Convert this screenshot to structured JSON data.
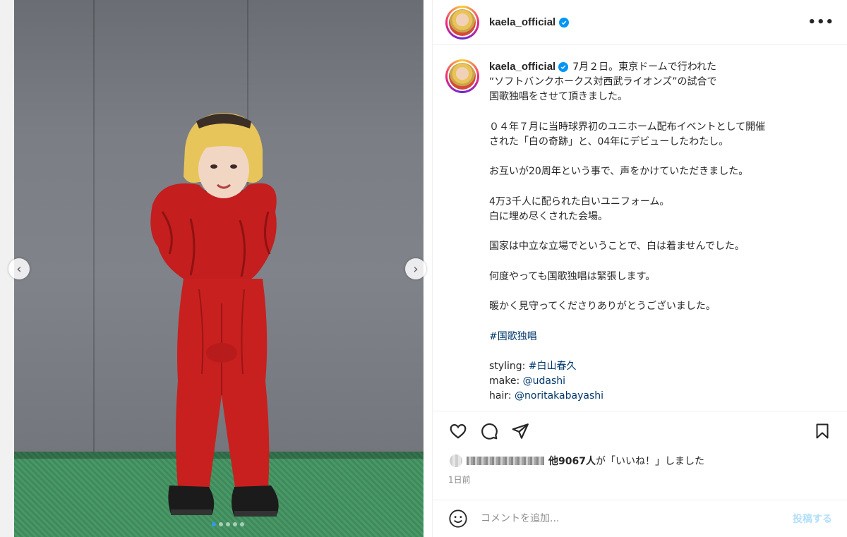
{
  "post": {
    "username": "kaela_official",
    "verified_icon": "verified-badge-icon",
    "more_icon": "more-options-icon",
    "caption_lines": [
      "7月２日。東京ドームで行われた",
      "“ソフトバンクホークス対西武ライオンズ”の試合で",
      "国歌独唱をさせて頂きました。",
      "",
      "０４年７月に当時球界初のユニホーム配布イベントとして開催",
      "された「白の奇跡」と、04年にデビューしたわたし。",
      "",
      "お互いが20周年という事で、声をかけていただきました。",
      "",
      "4万3千人に配られた白いユニフォーム。",
      "白に埋め尽くされた会場。",
      "",
      "国家は中立な立場でということで、白は着ませんでした。",
      "",
      "何度やっても国歌独唱は緊張します。",
      "",
      "暖かく見守ってくださりありがとうございました。",
      ""
    ],
    "hashtag": "#国歌独唱",
    "credits": {
      "styling_label": "styling: ",
      "styling_value": "#白山春久",
      "make_label": "make: ",
      "make_value": "@udashi",
      "hair_label": "hair: ",
      "hair_value": "@noritakabayashi"
    },
    "likes": {
      "count_text": "他9067人",
      "suffix": "が「いいね！」しました"
    },
    "time": "1日前",
    "comment": {
      "placeholder": "コメントを追加...",
      "post_label": "投稿する"
    }
  },
  "media": {
    "carousel_count": 5,
    "active_index": 0,
    "prev_icon": "chevron-left-icon",
    "next_icon": "chevron-right-icon"
  },
  "colors": {
    "accent": "#0095f6",
    "link": "#00376b",
    "dress_red": "#c41e1e"
  }
}
